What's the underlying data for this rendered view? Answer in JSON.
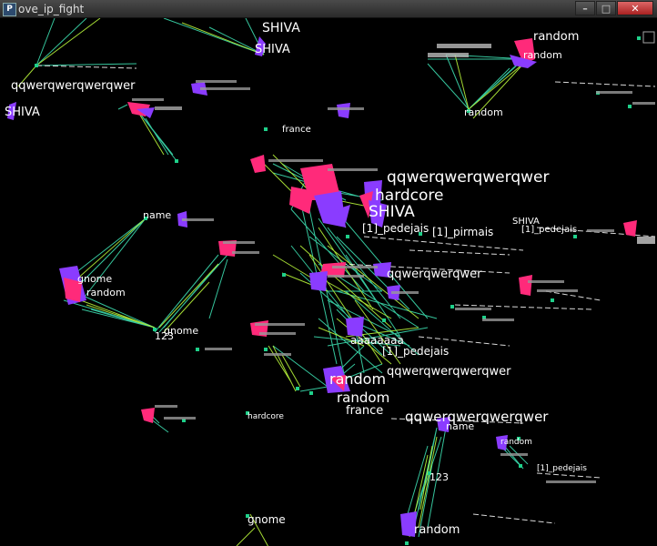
{
  "window": {
    "icon_glyph": "P",
    "title": "ove_ip_fight",
    "minimize_glyph": "–",
    "maximize_glyph": "□",
    "close_glyph": "✕"
  },
  "labels": {
    "shiva_1": "SHIVA",
    "shiva_2": "SHIVA",
    "qqwer_left": "qqwerqwerqwerqwer",
    "shiva_left": "SHIVA",
    "random_tr": "random",
    "random_tr2": "random",
    "random_tr3": "random",
    "qqwer_big": "qqwerqwerqwerqwer",
    "hardcore_big": "hardcore",
    "shiva_big": "SHIVA",
    "pedejais_mid": "[1]_pedejais",
    "pirmais_mid": "[1]_pirmais",
    "shiva_r": "SHIVA",
    "pedejais_r": "[1]_pedejais",
    "qqwer_mid": "qqwerqwerqwer",
    "name_left": "name",
    "gnome_left": "gnome",
    "random_left": "random",
    "gnome_mid": "gnome",
    "n123": "123",
    "aaaaaa": "aaaaaaaa",
    "pedejais_low": "[1]_pedejais",
    "qqwer_low": "qqwerqwerqwerqwer",
    "random_big": "random",
    "random_big2": "random",
    "france": "france",
    "qqwer_bottom": "qqwerqwerqwerqwer",
    "name_bottom": "name",
    "n123_b": "123",
    "gnome_b": "gnome",
    "random_b": "random",
    "random_r": "random",
    "hardcore_b": "hardcore",
    "france_top": "france",
    "pedejais_far": "[1]_pedejais"
  }
}
